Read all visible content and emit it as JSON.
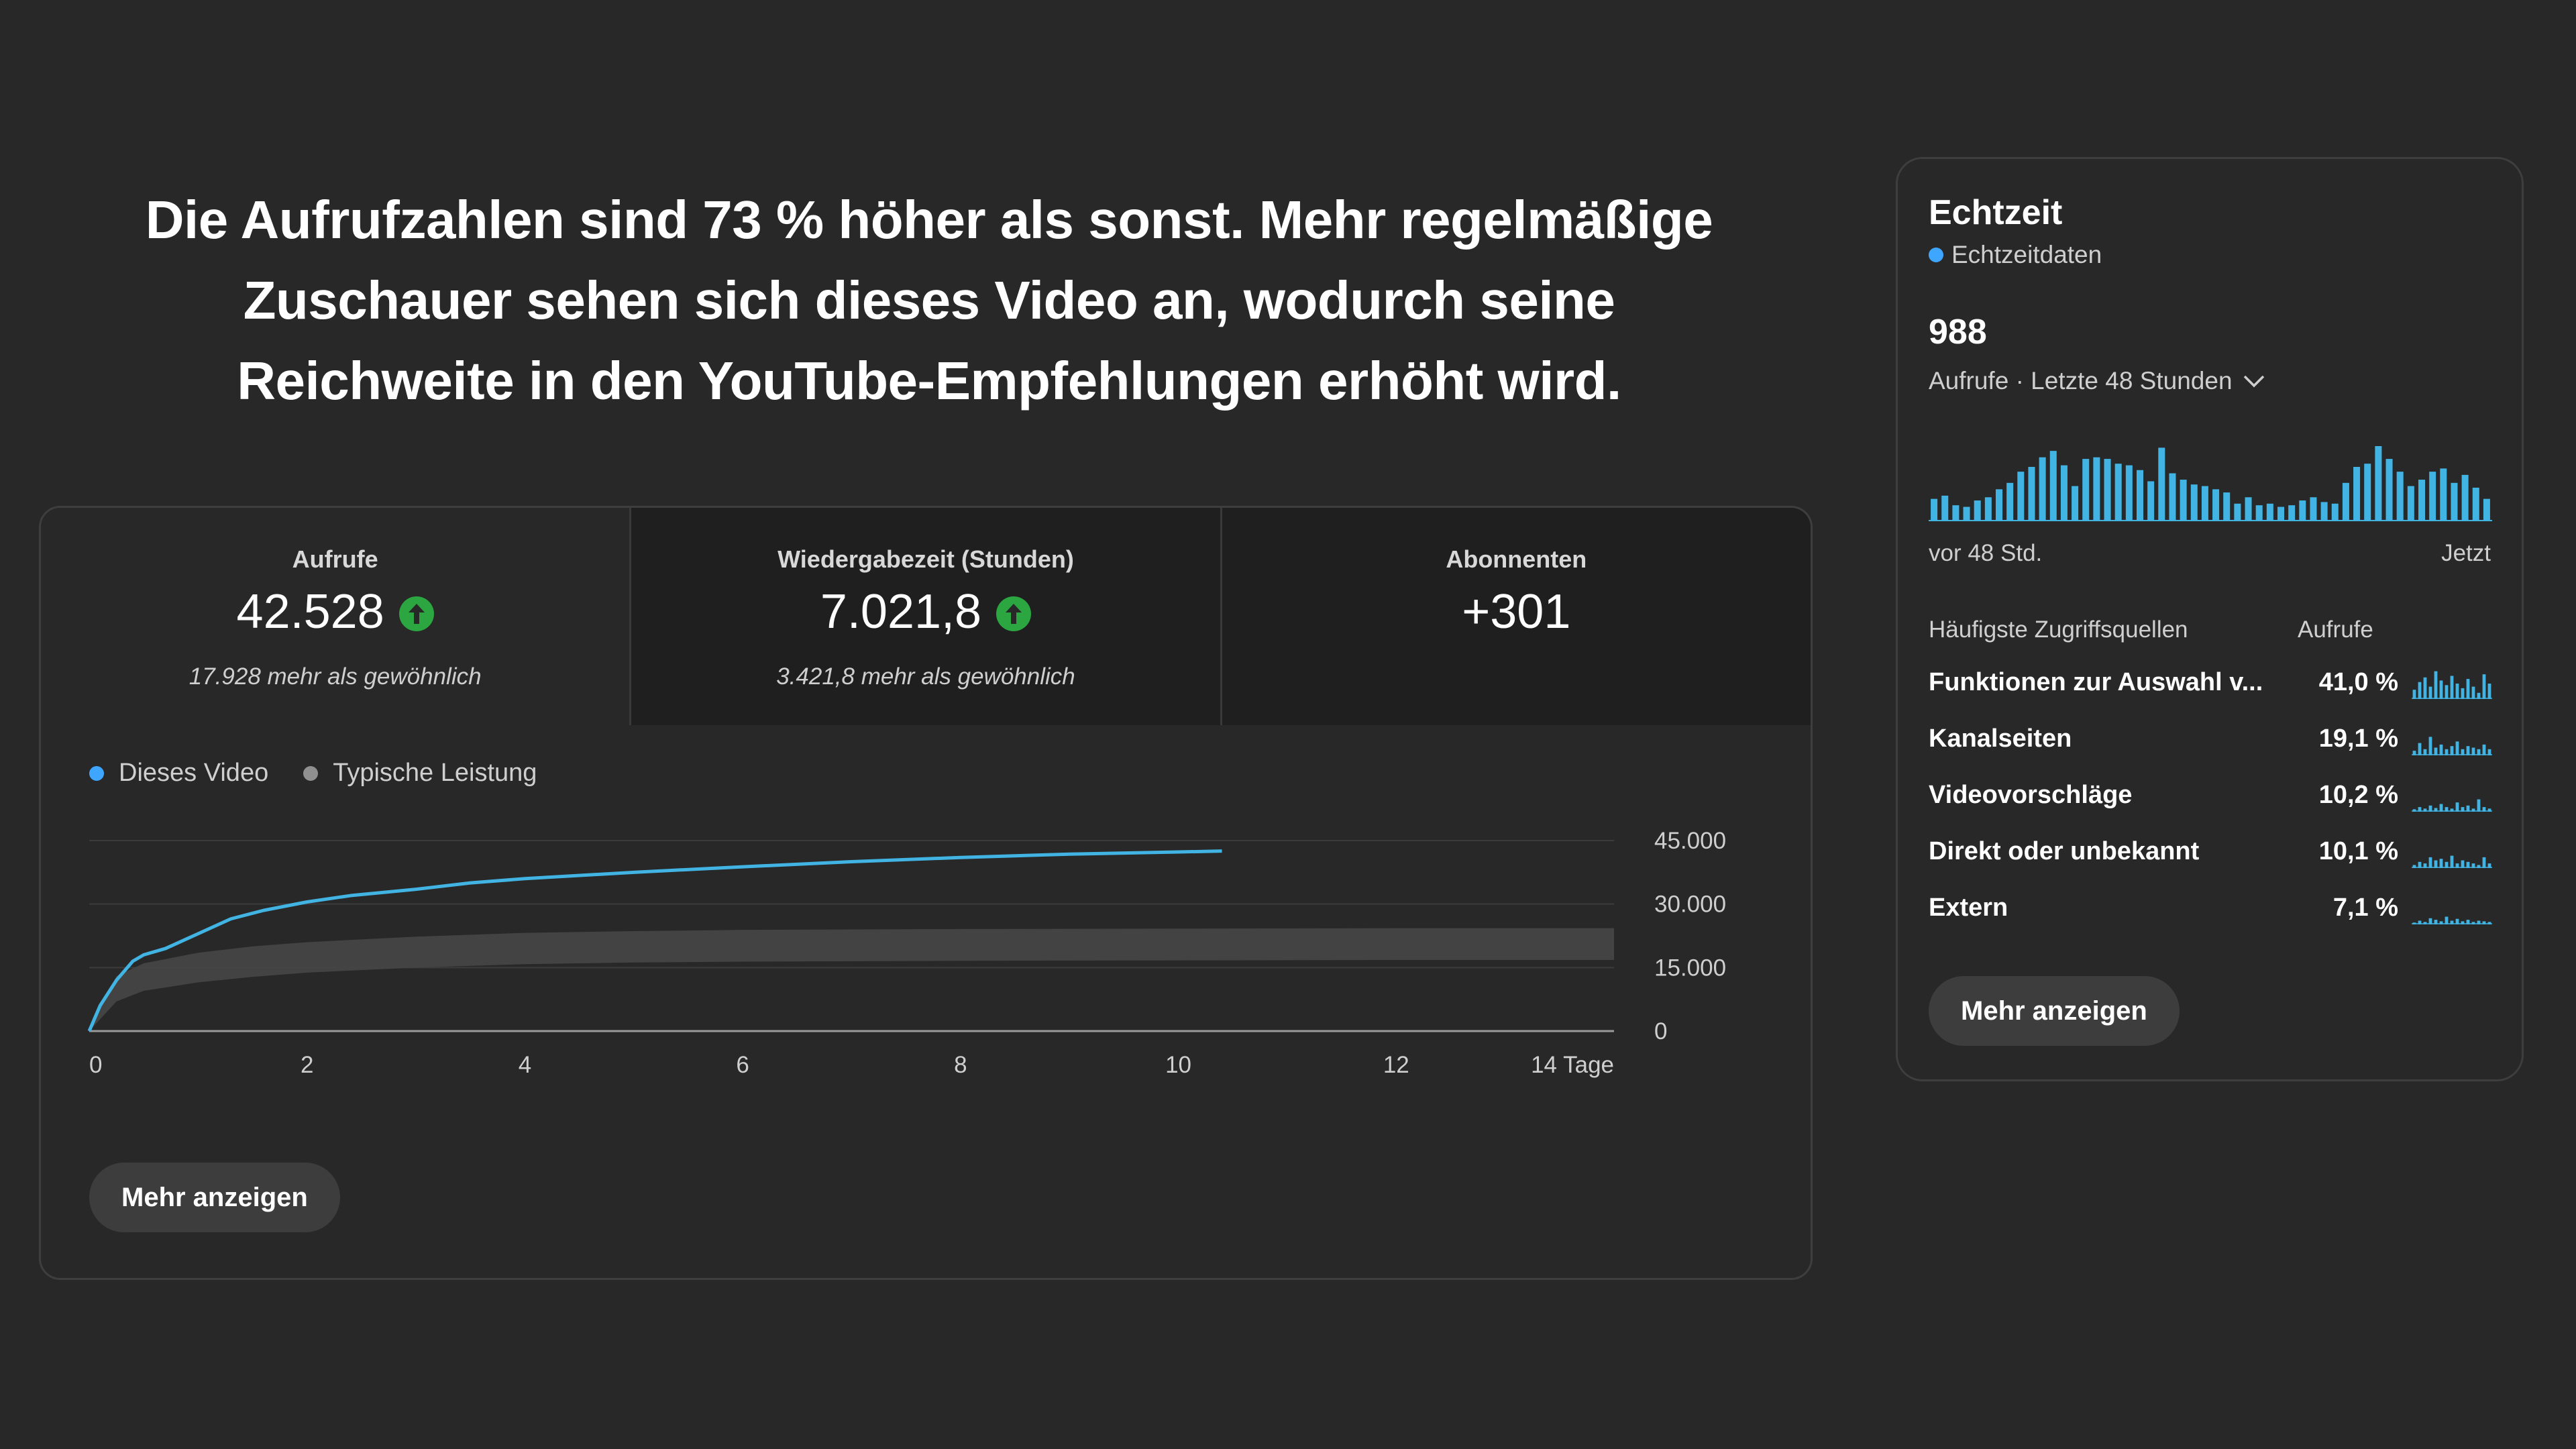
{
  "headline": "Die Aufrufzahlen sind 73 % höher als sonst. Mehr regelmäßige Zuschauer sehen sich dieses Video an, wodurch seine Reichweite in den YouTube-Empfehlungen erhöht wird.",
  "metrics": [
    {
      "label": "Aufrufe",
      "value": "42.528",
      "trend": "up",
      "sub": "17.928 mehr als gewöhnlich"
    },
    {
      "label": "Wiedergabezeit (Stunden)",
      "value": "7.021,8",
      "trend": "up",
      "sub": "3.421,8 mehr als gewöhnlich"
    },
    {
      "label": "Abonnenten",
      "value": "+301",
      "trend": "none",
      "sub": ""
    }
  ],
  "legend": {
    "this_video": "Dieses Video",
    "typical": "Typische Leistung"
  },
  "colors": {
    "accent": "#3ea6ff",
    "line": "#41b4e3",
    "band": "#444444",
    "up": "#2ba640",
    "background": "#282828"
  },
  "chart_data": {
    "type": "line",
    "x_unit": "Tage",
    "xlim": [
      0,
      14
    ],
    "ylim": [
      0,
      45000
    ],
    "x_ticks": [
      0,
      2,
      4,
      6,
      8,
      10,
      12,
      14
    ],
    "x_tick_labels": [
      "0",
      "2",
      "4",
      "6",
      "8",
      "10",
      "12",
      "14 Tage"
    ],
    "y_ticks": [
      0,
      15000,
      30000,
      45000
    ],
    "y_tick_labels": [
      "0",
      "15.000",
      "30.000",
      "45.000"
    ],
    "series": [
      {
        "name": "Dieses Video",
        "x": [
          0,
          0.1,
          0.25,
          0.4,
          0.5,
          0.7,
          1.0,
          1.3,
          1.6,
          2.0,
          2.4,
          3.0,
          3.5,
          4.0,
          5.0,
          6.0,
          7.0,
          8.0,
          9.0,
          10.0,
          10.4
        ],
        "y": [
          0,
          6000,
          12000,
          16500,
          18000,
          19500,
          23000,
          26500,
          28500,
          30500,
          32000,
          33500,
          35000,
          36000,
          37500,
          38800,
          40000,
          41000,
          41800,
          42300,
          42528
        ]
      },
      {
        "name": "Typische Leistung",
        "x": [
          0,
          0.25,
          0.5,
          1.0,
          1.5,
          2.0,
          3.0,
          4.0,
          5.0,
          6.0,
          8.0,
          10.0,
          12.0,
          14.0
        ],
        "y_low": [
          0,
          7000,
          9500,
          11500,
          12800,
          13800,
          15000,
          15800,
          16200,
          16400,
          16600,
          16700,
          16800,
          16800
        ],
        "y_high": [
          0,
          13000,
          16000,
          18500,
          20000,
          21000,
          22300,
          23200,
          23600,
          23900,
          24100,
          24200,
          24300,
          24300
        ]
      }
    ]
  },
  "main_more_button": "Mehr anzeigen",
  "realtime": {
    "title": "Echtzeit",
    "live_label": "Echtzeitdaten",
    "count": "988",
    "period": "Aufrufe · Letzte 48 Stunden",
    "axis_left": "vor 48 Std.",
    "axis_right": "Jetzt",
    "bars": [
      28,
      32,
      20,
      18,
      26,
      30,
      40,
      48,
      62,
      68,
      80,
      88,
      70,
      44,
      78,
      80,
      78,
      72,
      70,
      64,
      50,
      92,
      60,
      52,
      46,
      44,
      40,
      36,
      22,
      30,
      20,
      22,
      18,
      20,
      26,
      30,
      24,
      22,
      48,
      68,
      72,
      94,
      78,
      62,
      44,
      52,
      62,
      66,
      48,
      58,
      42,
      28
    ],
    "table_header_source": "Häufigste Zugriffsquellen",
    "table_header_views": "Aufrufe",
    "sources": [
      {
        "name": "Funktionen zur Auswahl v...",
        "pct": "41,0 %",
        "spark": [
          30,
          55,
          70,
          40,
          90,
          60,
          45,
          75,
          50,
          35,
          65,
          40,
          20,
          80,
          50
        ]
      },
      {
        "name": "Kanalseiten",
        "pct": "19,1 %",
        "spark": [
          15,
          40,
          20,
          60,
          25,
          35,
          20,
          30,
          45,
          20,
          30,
          25,
          20,
          35,
          20
        ]
      },
      {
        "name": "Videovorschläge",
        "pct": "10,2 %",
        "spark": [
          8,
          15,
          10,
          20,
          12,
          25,
          15,
          10,
          30,
          15,
          20,
          10,
          40,
          15,
          10
        ]
      },
      {
        "name": "Direkt oder unbekannt",
        "pct": "10,1 %",
        "spark": [
          10,
          20,
          15,
          35,
          25,
          30,
          20,
          40,
          15,
          25,
          20,
          15,
          10,
          35,
          15
        ]
      },
      {
        "name": "Extern",
        "pct": "7,1 %",
        "spark": [
          6,
          12,
          8,
          20,
          15,
          10,
          25,
          12,
          18,
          10,
          15,
          8,
          12,
          10,
          8
        ]
      }
    ],
    "more_button": "Mehr anzeigen"
  }
}
